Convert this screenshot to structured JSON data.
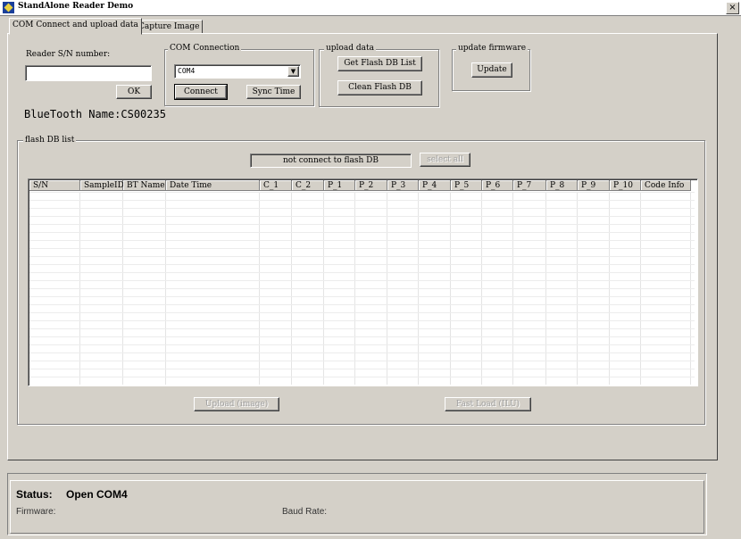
{
  "window": {
    "title": "StandAlone Reader Demo",
    "close_glyph": "×"
  },
  "tabs": [
    {
      "label": "COM Connect and upload data",
      "active": true
    },
    {
      "label": "Capture Image",
      "active": false
    }
  ],
  "reader": {
    "label": "Reader S/N number:",
    "input_value": "",
    "ok_label": "OK",
    "bluetooth_name": "BlueTooth Name:CS00235"
  },
  "com_connection": {
    "title": "COM Connection",
    "selected_port": "COM4",
    "connect_label": "Connect",
    "sync_time_label": "Sync Time"
  },
  "upload_data": {
    "title": "upload data",
    "get_flash_label": "Get Flash DB List",
    "clean_flash_label": "Clean Flash DB"
  },
  "update_firmware": {
    "title": "update firmware",
    "update_label": "Update"
  },
  "flash_db": {
    "title": "flash DB list",
    "status_text": "not connect to flash DB",
    "select_all_label": "select all",
    "columns": [
      "S/N",
      "SampleID",
      "BT Name",
      "Date Time",
      "C_1",
      "C_2",
      "P_1",
      "P_2",
      "P_3",
      "P_4",
      "P_5",
      "P_6",
      "P_7",
      "P_8",
      "P_9",
      "P_10",
      "Code Info"
    ],
    "rows": [],
    "upload_image_label": "Upload (image)",
    "fast_load_label": "Fast Load (ILU)"
  },
  "status": {
    "status_label": "Status:",
    "status_value": "Open COM4",
    "firmware_label": "Firmware:",
    "baud_rate_label": "Baud Rate:"
  }
}
